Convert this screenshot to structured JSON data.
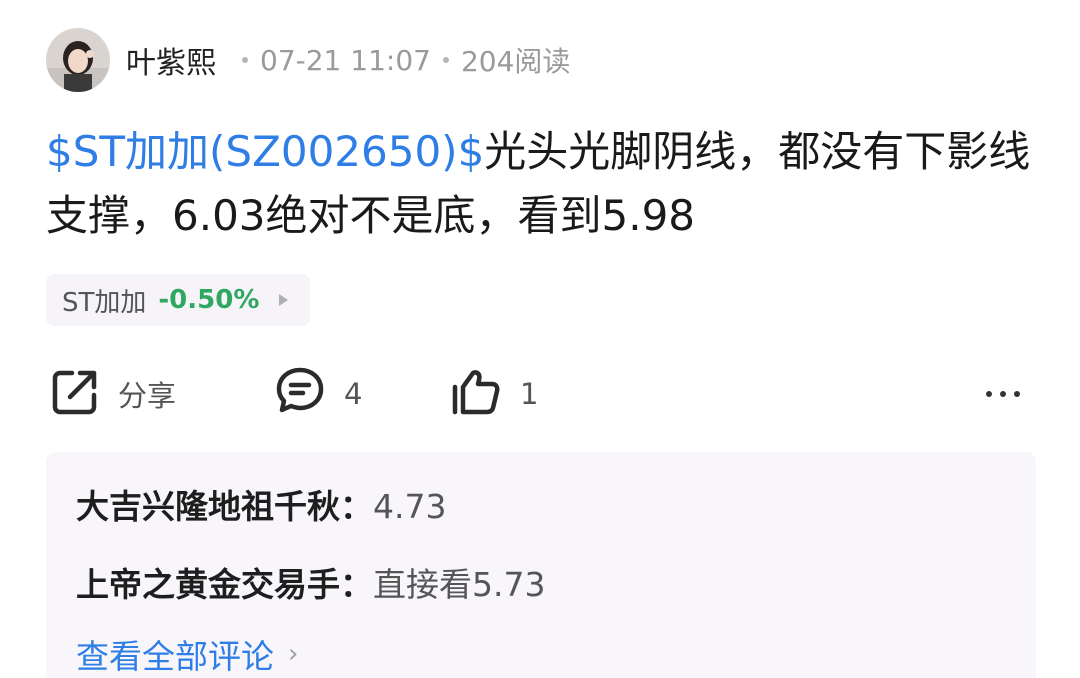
{
  "header": {
    "author": "叶紫熙",
    "time": "07-21 11:07",
    "reads": "204阅读"
  },
  "post": {
    "stock_link": "$ST加加(SZ002650)$",
    "text": "光头光脚阴线，都没有下影线支撑，6.03绝对不是底，看到5.98"
  },
  "stock_chip": {
    "name": "ST加加",
    "change": "-0.50%",
    "change_color": "#2ea861"
  },
  "actions": {
    "share_label": "分享",
    "comment_count": "4",
    "like_count": "1"
  },
  "comments": {
    "items": [
      {
        "user": "大吉兴隆地祖千秋：",
        "text": "4.73"
      },
      {
        "user": "上帝之黄金交易手：",
        "text": "直接看5.73"
      }
    ],
    "view_all": "查看全部评论"
  },
  "colors": {
    "link": "#2e7ee6",
    "down": "#2ea861"
  }
}
